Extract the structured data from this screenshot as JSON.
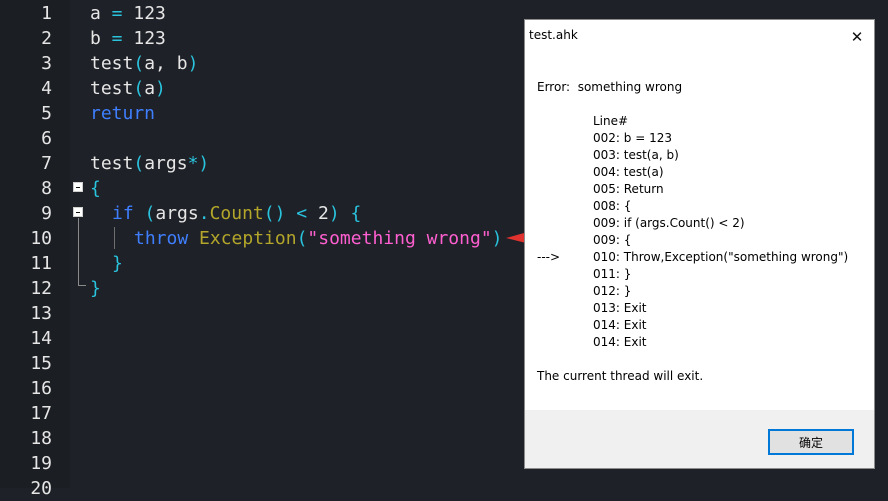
{
  "editor": {
    "line_numbers": [
      "1",
      "2",
      "3",
      "4",
      "5",
      "6",
      "7",
      "8",
      "9",
      "10",
      "11",
      "12",
      "13",
      "14",
      "15",
      "16",
      "17",
      "18",
      "19",
      "20"
    ],
    "lines": {
      "l1": {
        "a": "a",
        "eq": " = ",
        "n": "123"
      },
      "l2": {
        "a": "b",
        "eq": " = ",
        "n": "123"
      },
      "l3": {
        "fn": "test",
        "p1": "(",
        "args": "a, b",
        "p2": ")"
      },
      "l4": {
        "fn": "test",
        "p1": "(",
        "args": "a",
        "p2": ")"
      },
      "l5": {
        "kw": "return"
      },
      "l7": {
        "fn": "test",
        "p1": "(",
        "args": "args",
        "star": "*",
        "p2": ")"
      },
      "l8": {
        "brace": "{"
      },
      "l9": {
        "kw": "if",
        "p1": " (",
        "obj": "args",
        "dot": ".",
        "method": "Count",
        "call": "()",
        "lt": " < ",
        "n": "2",
        "p2": ")",
        "brace": " {"
      },
      "l10": {
        "kw": "throw",
        "cls": "Exception",
        "p1": "(",
        "str": "\"something wrong\"",
        "p2": ")"
      },
      "l11": {
        "brace": "}"
      },
      "l12": {
        "brace": "}"
      }
    }
  },
  "dialog": {
    "title": "test.ahk",
    "close_glyph": "✕",
    "error_line": "Error:  something wrong",
    "line_header": "Line#",
    "lines": [
      "002: b = 123",
      "003: test(a, b)",
      "004: test(a)",
      "005: Return",
      "008: {",
      "009: if (args.Count() < 2)",
      "009: {",
      "010: Throw,Exception(\"something wrong\")",
      "011: }",
      "012: }",
      "013: Exit",
      "014: Exit",
      "014: Exit"
    ],
    "pointer": "--->",
    "footer_text": "The current thread will exit.",
    "ok_label": "确定"
  },
  "colors": {
    "editor_bg": "#1e2127",
    "keyword": "#3f7fff",
    "operator": "#2ac3de",
    "class": "#b3a62a",
    "string": "#ff5fd1",
    "annotation_arrow": "#e0322f",
    "button_focus": "#0078d7"
  },
  "icons": {
    "fold_marker": "minus-box-icon",
    "close": "close-icon",
    "annotation": "red-arrow-icon"
  }
}
